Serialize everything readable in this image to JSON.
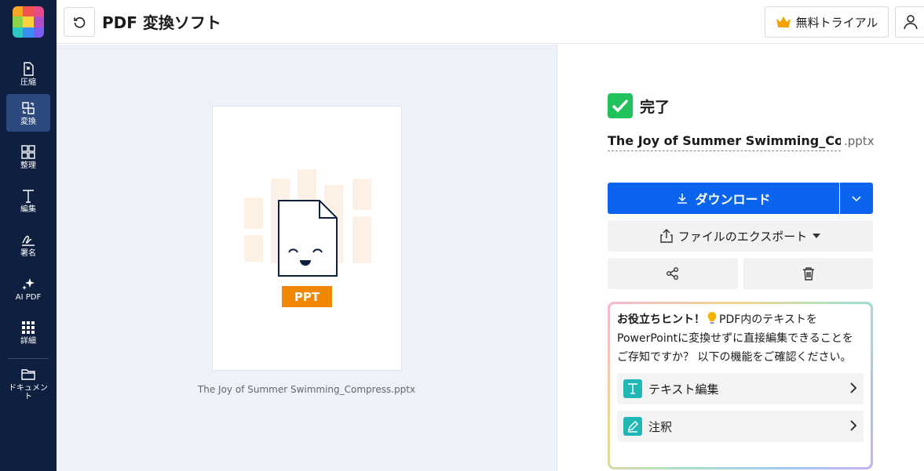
{
  "header": {
    "title": "PDF 変換ソフト",
    "trial_label": "無料トライアル"
  },
  "sidebar": {
    "items": [
      {
        "label": "圧縮",
        "icon": "compress-icon"
      },
      {
        "label": "変換",
        "icon": "convert-icon",
        "active": true
      },
      {
        "label": "整理",
        "icon": "organize-icon"
      },
      {
        "label": "編集",
        "icon": "edit-text-icon"
      },
      {
        "label": "署名",
        "icon": "signature-icon"
      },
      {
        "label": "AI PDF",
        "icon": "ai-sparkle-icon"
      },
      {
        "label": "詳細",
        "icon": "grid-icon"
      },
      {
        "label": "ドキュメント",
        "icon": "folder-icon"
      }
    ]
  },
  "preview": {
    "filename": "The Joy of Summer Swimming_Compress.pptx",
    "badge": "PPT"
  },
  "result": {
    "status": "完了",
    "file_name": "The Joy of Summer Swimming_Co...",
    "file_ext": ".pptx",
    "download_label": "ダウンロード",
    "export_label": "ファイルのエクスポート"
  },
  "hint": {
    "title": "お役立ちヒント！",
    "body": "PDF内のテキストをPowerPointに変換せずに直接編集できることをご存知ですか？ 以下の機能をご確認ください。",
    "items": [
      {
        "label": "テキスト編集",
        "icon": "text-edit-icon"
      },
      {
        "label": "注釈",
        "icon": "annotate-pen-icon"
      }
    ]
  },
  "colors": {
    "sidebar_bg": "#0e1f3f",
    "primary": "#0a64ee",
    "success": "#21c15b",
    "ppt_orange": "#f28705"
  }
}
